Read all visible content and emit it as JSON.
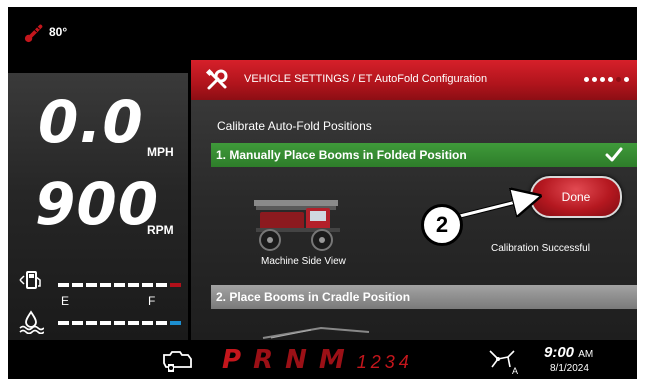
{
  "status": {
    "temperature": "80°"
  },
  "gauges": {
    "speed": {
      "value": "0.0",
      "unit": "MPH"
    },
    "engine": {
      "value": "900",
      "unit": "RPM"
    },
    "fuel": {
      "empty_label": "E",
      "full_label": "F",
      "level": 0.95
    },
    "def": {
      "level": 0.95
    }
  },
  "panel": {
    "title": "VEHICLE SETTINGS / ET AutoFold Configuration",
    "subtitle": "Calibrate Auto-Fold Positions",
    "step1": {
      "label": "1. Manually Place Booms in Folded Position",
      "status_icon": "check-icon"
    },
    "machine_label": "Machine Side View",
    "done_button": "Done",
    "status_message": "Calibration Successful",
    "step2": {
      "label": "2. Place Booms in Cradle Position"
    },
    "page_indicator": {
      "total": 6,
      "current": 5
    }
  },
  "callout": {
    "number": "2"
  },
  "bottom": {
    "gears": [
      "P",
      "R",
      "N",
      "M"
    ],
    "gear_numbers": "1234",
    "time": "9:00",
    "ampm": "AM",
    "date": "8/1/2024",
    "steer_mode": "A"
  },
  "colors": {
    "accent_red": "#c4161c",
    "success_green": "#3f9a3a",
    "def_blue": "#1d8fd0"
  }
}
